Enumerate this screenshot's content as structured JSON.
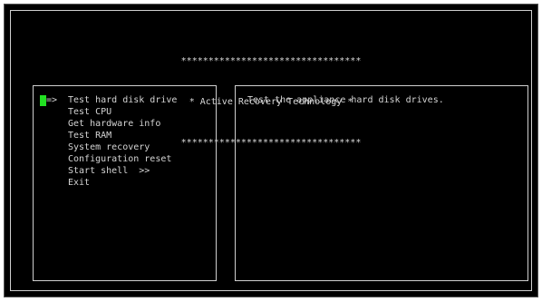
{
  "banner": {
    "top_rule": "*********************************",
    "title": "* Active Recovery Technology *",
    "bottom_rule": "*********************************"
  },
  "menu": {
    "selection_marker": "=>",
    "items": [
      {
        "label": "Test hard disk drive",
        "selected": true
      },
      {
        "label": "Test CPU",
        "selected": false
      },
      {
        "label": "Get hardware info",
        "selected": false
      },
      {
        "label": "Test RAM",
        "selected": false
      },
      {
        "label": "System recovery",
        "selected": false
      },
      {
        "label": "Configuration reset",
        "selected": false
      },
      {
        "label": "Start shell  >>",
        "selected": false
      },
      {
        "label": "Exit",
        "selected": false
      }
    ]
  },
  "description": {
    "text": "Test the appliance hard disk drives."
  },
  "colors": {
    "background": "#000000",
    "text": "#d4d4d4",
    "cursor": "#22e022"
  }
}
